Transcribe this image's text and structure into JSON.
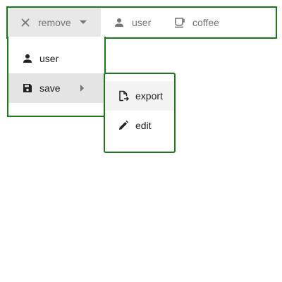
{
  "menubar": {
    "items": [
      {
        "label": "remove",
        "icon": "close-icon",
        "active": true
      },
      {
        "label": "user",
        "icon": "person-icon"
      },
      {
        "label": "coffee",
        "icon": "coffee-icon"
      }
    ]
  },
  "dropdown": {
    "items": [
      {
        "label": "user",
        "icon": "person-icon"
      },
      {
        "label": "save",
        "icon": "save-icon",
        "has_submenu": true
      }
    ]
  },
  "submenu": {
    "items": [
      {
        "label": "export",
        "icon": "file-export-icon"
      },
      {
        "label": "edit",
        "icon": "pencil-icon"
      }
    ]
  },
  "colors": {
    "border": "#1a7a1a",
    "active_bg": "#e8e8e8",
    "highlight_bg": "#e4e4e4",
    "text": "#212121",
    "muted_text": "#757575"
  }
}
